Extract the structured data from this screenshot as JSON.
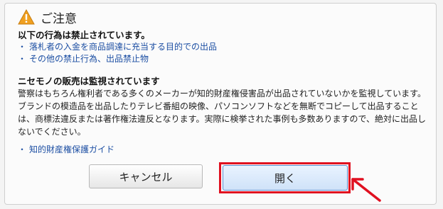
{
  "dialog": {
    "title": "ご注意",
    "prohibited_heading": "以下の行為は禁止されています。",
    "prohibited_items": [
      "落札者の入金を商品調達に充当する目的での出品",
      "その他の禁止行為、出品禁止物"
    ],
    "counterfeit_heading": "ニセモノの販売は監視されています",
    "counterfeit_body": "警察はもちろん権利者である多くのメーカーが知的財産権侵害品が出品されていないかを監視しています。ブランドの模造品を出品したりテレビ番組の映像、パソコンソフトなどを無断でコピーして出品することは、商標法違反または著作権法違反となります。実際に検挙された事例も多数ありますので、絶対に出品しないでください。",
    "guide_link": "知的財産権保護ガイド",
    "bullet": "・",
    "cancel_label": "キャンセル",
    "open_label": "開く"
  },
  "colors": {
    "link": "#1d4fa3",
    "highlight": "#e01020",
    "warning_icon": "#f0a020"
  },
  "icons": {
    "warning": "warning-icon",
    "arrow": "pointer-arrow-icon"
  }
}
